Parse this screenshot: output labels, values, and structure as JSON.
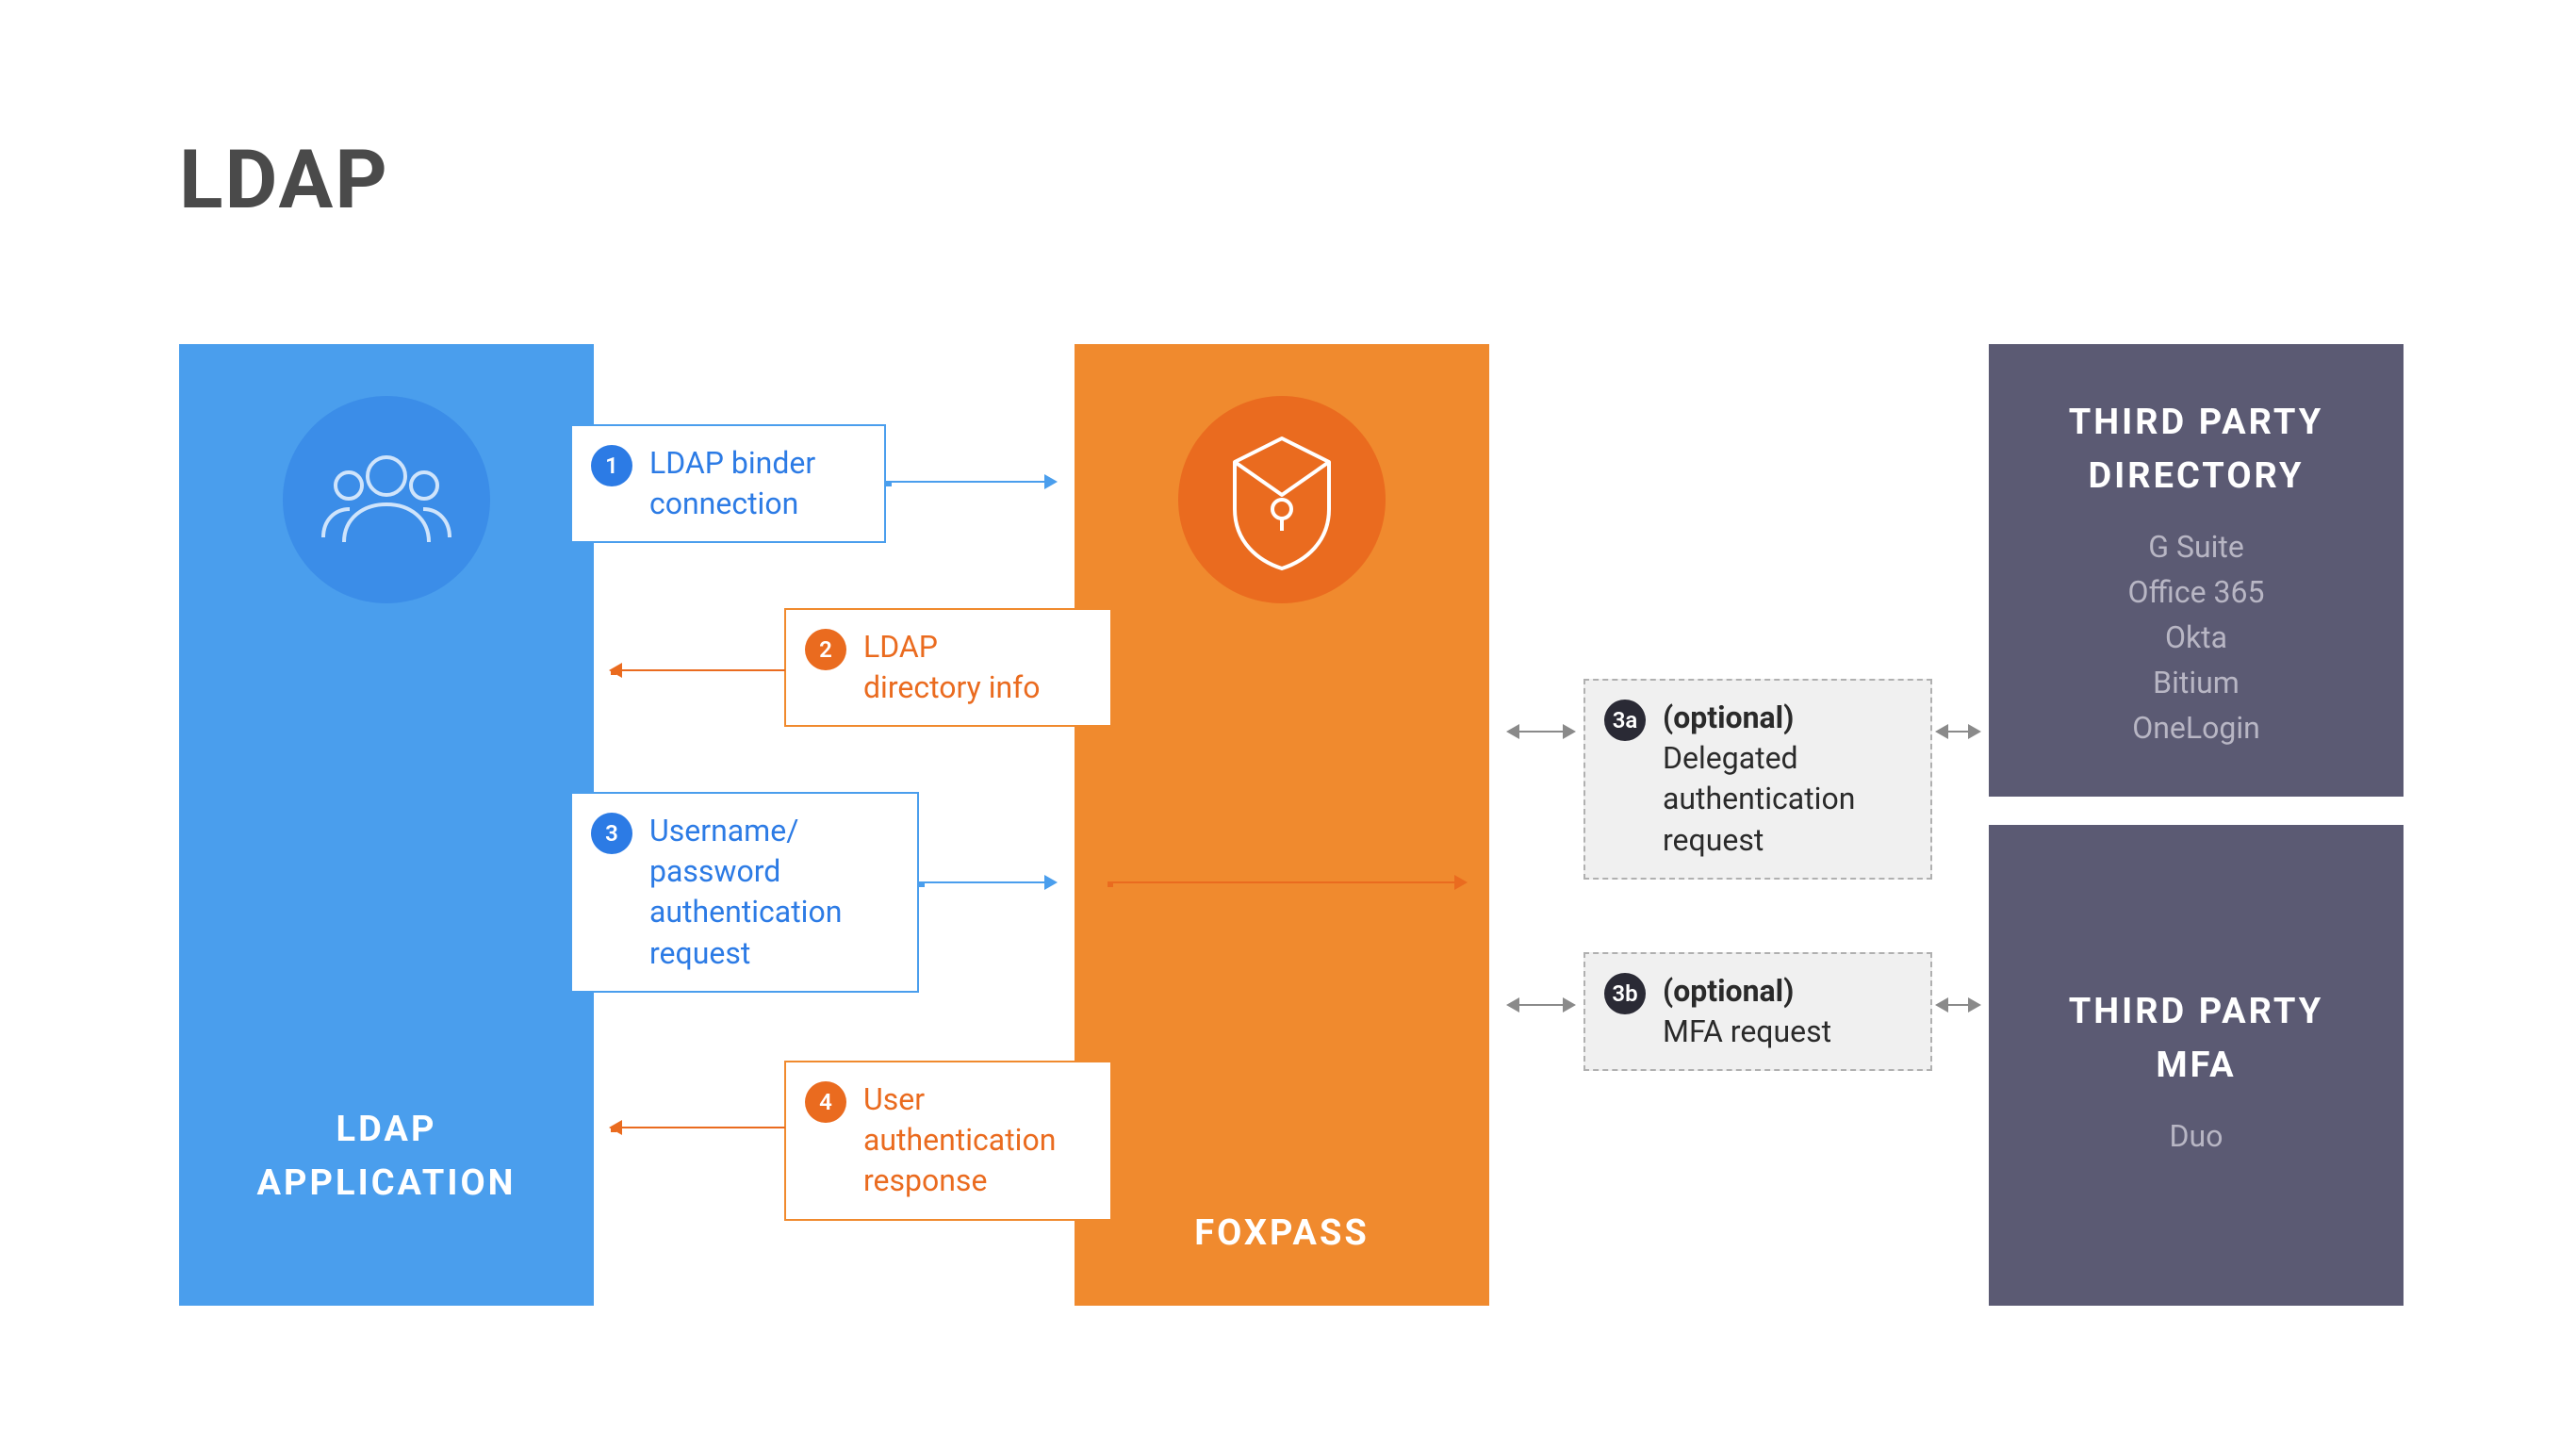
{
  "title": "LDAP",
  "columns": {
    "ldap": {
      "title_l1": "LDAP",
      "title_l2": "APPLICATION"
    },
    "foxpass": {
      "title": "FOXPASS"
    },
    "directory": {
      "title_l1": "THIRD PARTY",
      "title_l2": "DIRECTORY",
      "items": [
        "G Suite",
        "Office 365",
        "Okta",
        "Bitium",
        "OneLogin"
      ]
    },
    "mfa": {
      "title_l1": "THIRD PARTY",
      "title_l2": "MFA",
      "items": [
        "Duo"
      ]
    }
  },
  "steps": {
    "s1": {
      "num": "1",
      "l1": "LDAP binder",
      "l2": "connection"
    },
    "s2": {
      "num": "2",
      "l1": "LDAP",
      "l2": "directory info"
    },
    "s3": {
      "num": "3",
      "l1": "Username/",
      "l2": "password",
      "l3": "authentication",
      "l4": "request"
    },
    "s4": {
      "num": "4",
      "l1": "User",
      "l2": "authentication",
      "l3": "response"
    },
    "s3a": {
      "num": "3a",
      "opt": "(optional)",
      "l1": "Delegated",
      "l2": "authentication",
      "l3": "request"
    },
    "s3b": {
      "num": "3b",
      "opt": "(optional)",
      "l1": "MFA request"
    }
  }
}
